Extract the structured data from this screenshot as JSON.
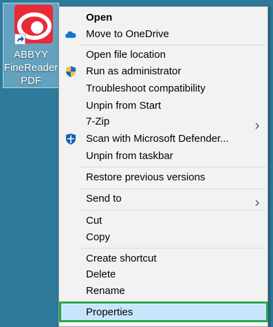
{
  "desktop": {
    "background_color": "#2e7a9a",
    "shortcut": {
      "label_lines": [
        "ABBYY",
        "FineReader",
        "PDF"
      ],
      "icon": "abbyy-finereader-logo",
      "overlay_icon": "shortcut-arrow-icon"
    }
  },
  "context_menu": {
    "items": [
      {
        "label": "Open",
        "bold": true
      },
      {
        "label": "Move to OneDrive",
        "icon": "onedrive-cloud-icon"
      },
      {
        "label": "Open file location"
      },
      {
        "label": "Run as administrator",
        "icon": "uac-shield-icon"
      },
      {
        "label": "Troubleshoot compatibility"
      },
      {
        "label": "Unpin from Start"
      },
      {
        "label": "7-Zip",
        "submenu": true
      },
      {
        "label": "Scan with Microsoft Defender...",
        "icon": "defender-shield-icon"
      },
      {
        "label": "Unpin from taskbar"
      },
      {
        "label": "Restore previous versions"
      },
      {
        "label": "Send to",
        "submenu": true
      },
      {
        "label": "Cut"
      },
      {
        "label": "Copy"
      },
      {
        "label": "Create shortcut"
      },
      {
        "label": "Delete"
      },
      {
        "label": "Rename"
      },
      {
        "label": "Properties",
        "selected": true
      }
    ],
    "highlight_color": "#1eaa48",
    "selected_color": "#c8e6fb"
  }
}
